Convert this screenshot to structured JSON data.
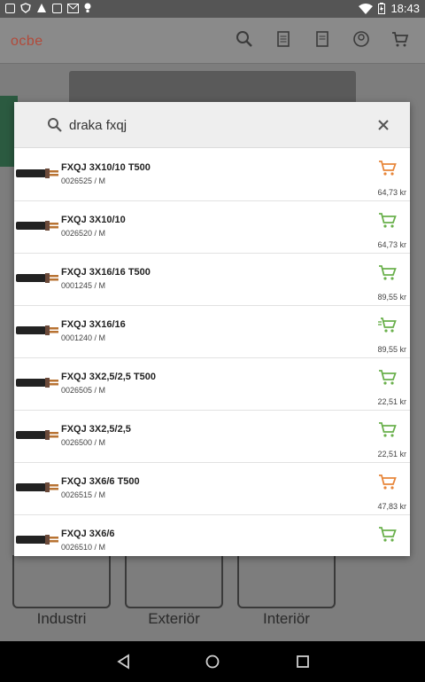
{
  "status": {
    "time": "18:43"
  },
  "app": {
    "logo": "ocbe"
  },
  "categories": [
    "Industri",
    "Exteriör",
    "Interiör"
  ],
  "search": {
    "query": "draka fxqj",
    "placeholder": ""
  },
  "colors": {
    "cart_orange": "#e8863a",
    "cart_green": "#6ab04c"
  },
  "results": [
    {
      "name": "FXQJ 3X10/10 T500",
      "sku": "0026525 / M",
      "price": "64,73 kr",
      "cart": "cart-orange",
      "cart_color": "#e8863a"
    },
    {
      "name": "FXQJ 3X10/10",
      "sku": "0026520 / M",
      "price": "64,73 kr",
      "cart": "cart-green",
      "cart_color": "#6ab04c"
    },
    {
      "name": "FXQJ 3X16/16 T500",
      "sku": "0001245 / M",
      "price": "89,55 kr",
      "cart": "cart-green",
      "cart_color": "#6ab04c"
    },
    {
      "name": "FXQJ 3X16/16",
      "sku": "0001240 / M",
      "price": "89,55 kr",
      "cart": "cart-fast",
      "cart_color": "#6ab04c"
    },
    {
      "name": "FXQJ 3X2,5/2,5 T500",
      "sku": "0026505 / M",
      "price": "22,51 kr",
      "cart": "cart-green",
      "cart_color": "#6ab04c"
    },
    {
      "name": "FXQJ 3X2,5/2,5",
      "sku": "0026500 / M",
      "price": "22,51 kr",
      "cart": "cart-green",
      "cart_color": "#6ab04c"
    },
    {
      "name": "FXQJ 3X6/6 T500",
      "sku": "0026515 / M",
      "price": "47,83 kr",
      "cart": "cart-orange",
      "cart_color": "#e8863a"
    },
    {
      "name": "FXQJ 3X6/6",
      "sku": "0026510 / M",
      "price": "",
      "cart": "cart-green",
      "cart_color": "#6ab04c"
    }
  ]
}
